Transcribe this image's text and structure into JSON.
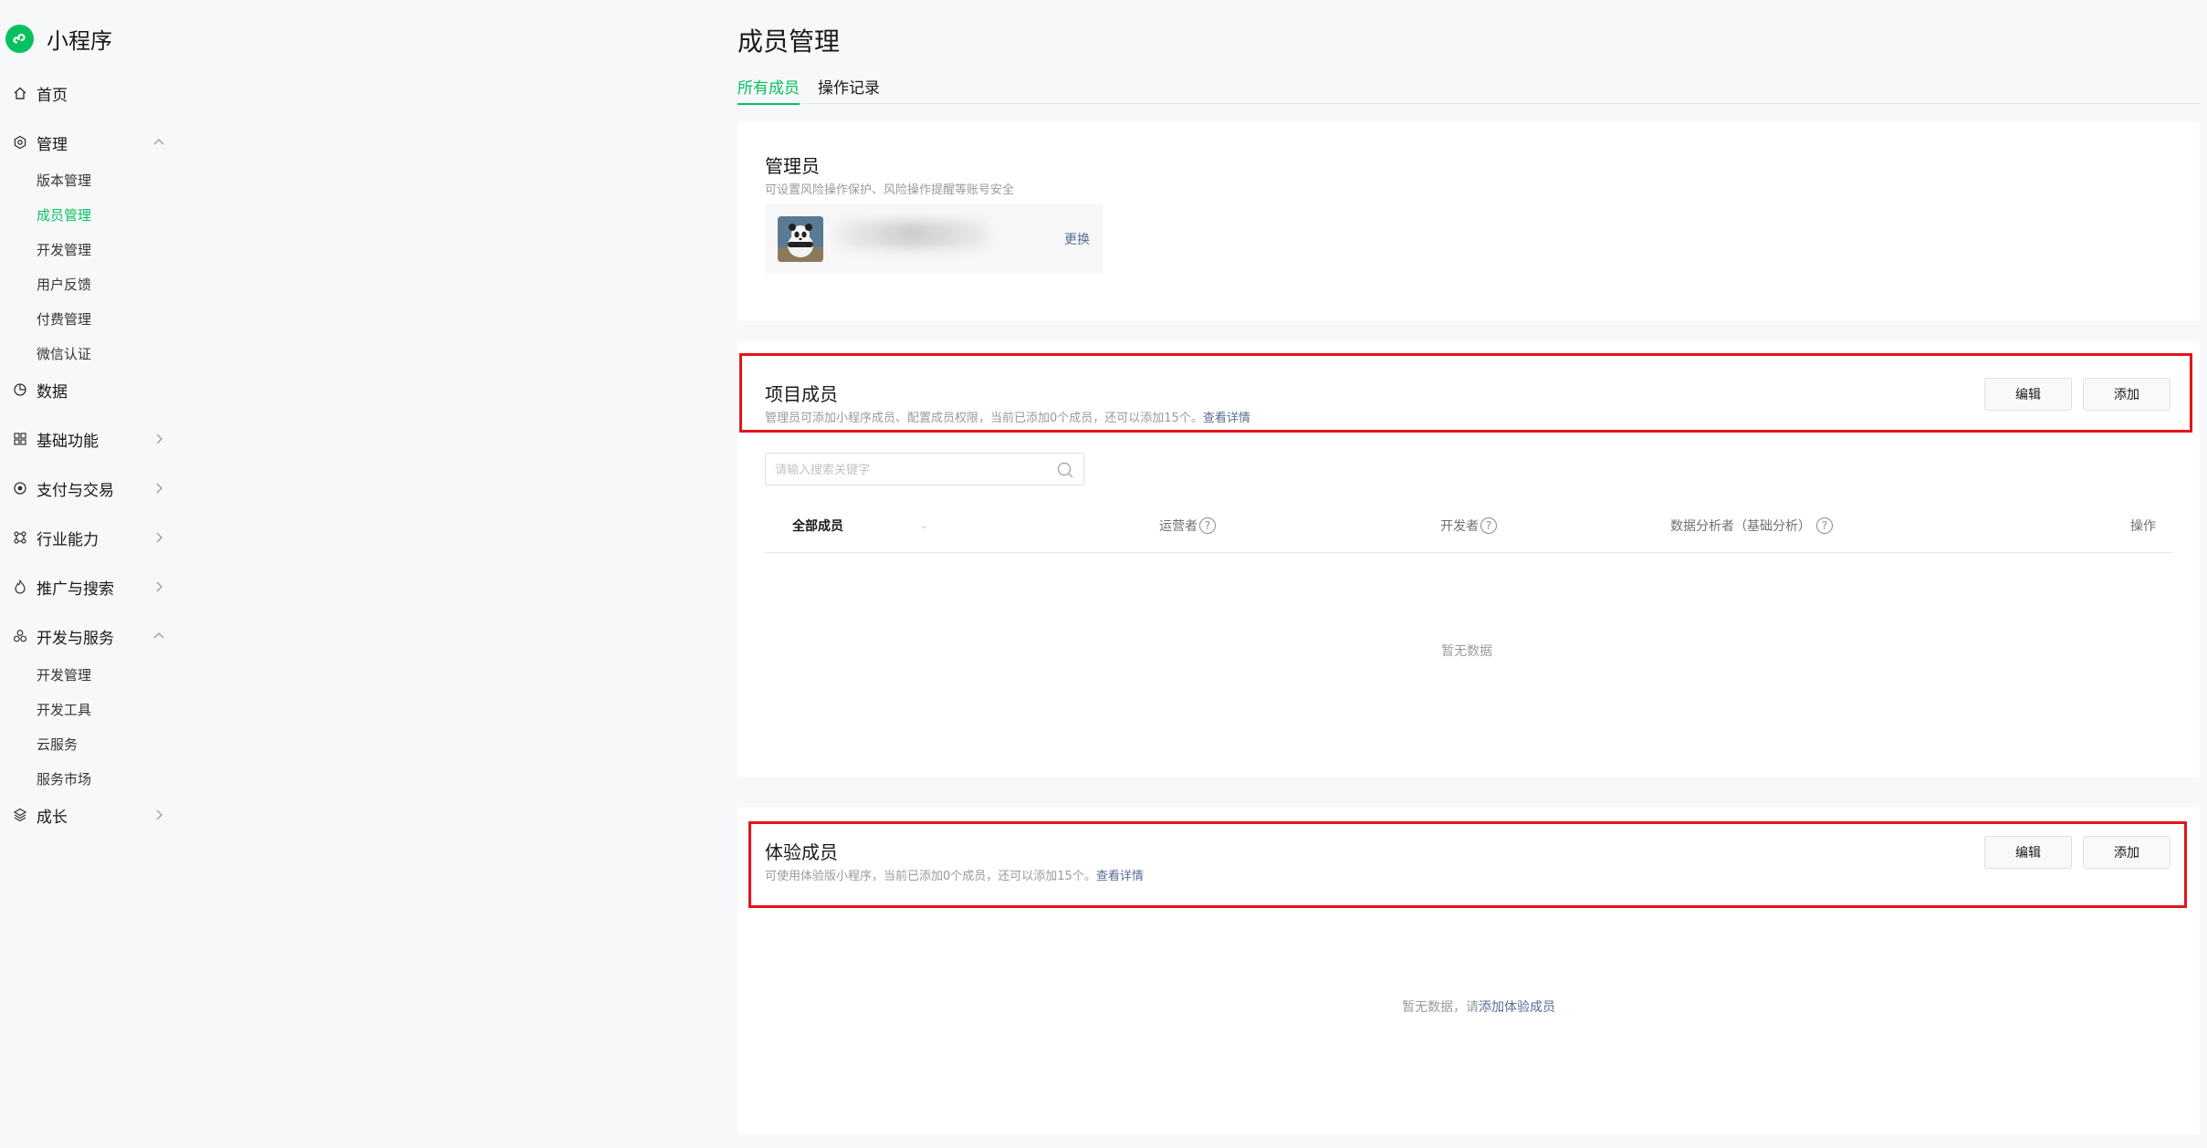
{
  "app": {
    "name": "小程序"
  },
  "sidebar": {
    "items": [
      {
        "label": "首页"
      },
      {
        "label": "管理",
        "children": [
          {
            "label": "版本管理"
          },
          {
            "label": "成员管理"
          },
          {
            "label": "开发管理"
          },
          {
            "label": "用户反馈"
          },
          {
            "label": "付费管理"
          },
          {
            "label": "微信认证"
          }
        ]
      },
      {
        "label": "数据"
      },
      {
        "label": "基础功能"
      },
      {
        "label": "支付与交易"
      },
      {
        "label": "行业能力"
      },
      {
        "label": "推广与搜索"
      },
      {
        "label": "开发与服务",
        "children": [
          {
            "label": "开发管理"
          },
          {
            "label": "开发工具"
          },
          {
            "label": "云服务"
          },
          {
            "label": "服务市场"
          }
        ]
      },
      {
        "label": "成长"
      }
    ],
    "active_item": "成员管理"
  },
  "page": {
    "title": "成员管理",
    "tabs": [
      {
        "label": "所有成员"
      },
      {
        "label": "操作记录"
      }
    ],
    "active_tab": "所有成员"
  },
  "admin": {
    "title": "管理员",
    "desc": "可设置风险操作保护、风险操作提醒等账号安全",
    "change_label": "更换"
  },
  "project_members": {
    "title": "项目成员",
    "desc": "管理员可添加小程序成员、配置成员权限，当前已添加0个成员，还可以添加15个。",
    "detail_link": "查看详情",
    "edit_label": "编辑",
    "add_label": "添加",
    "search_placeholder": "请输入搜索关键字",
    "columns": [
      "全部成员",
      "运营者",
      "开发者",
      "数据分析者（基础分析）",
      "操作"
    ],
    "empty_text": "暂无数据"
  },
  "trial_members": {
    "title": "体验成员",
    "desc": "可使用体验版小程序，当前已添加0个成员，还可以添加15个。",
    "detail_link": "查看详情",
    "edit_label": "编辑",
    "add_label": "添加",
    "empty_text": "暂无数据，请",
    "empty_link": "添加体验成员"
  },
  "colors": {
    "brand": "#07c160",
    "link": "#576b95",
    "highlight": "#e4141b"
  }
}
